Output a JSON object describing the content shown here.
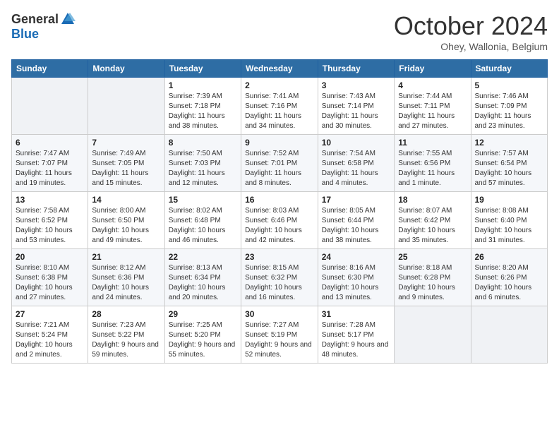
{
  "header": {
    "logo_general": "General",
    "logo_blue": "Blue",
    "month_title": "October 2024",
    "location": "Ohey, Wallonia, Belgium"
  },
  "weekdays": [
    "Sunday",
    "Monday",
    "Tuesday",
    "Wednesday",
    "Thursday",
    "Friday",
    "Saturday"
  ],
  "weeks": [
    [
      {
        "day": "",
        "sunrise": "",
        "sunset": "",
        "daylight": ""
      },
      {
        "day": "",
        "sunrise": "",
        "sunset": "",
        "daylight": ""
      },
      {
        "day": "1",
        "sunrise": "Sunrise: 7:39 AM",
        "sunset": "Sunset: 7:18 PM",
        "daylight": "Daylight: 11 hours and 38 minutes."
      },
      {
        "day": "2",
        "sunrise": "Sunrise: 7:41 AM",
        "sunset": "Sunset: 7:16 PM",
        "daylight": "Daylight: 11 hours and 34 minutes."
      },
      {
        "day": "3",
        "sunrise": "Sunrise: 7:43 AM",
        "sunset": "Sunset: 7:14 PM",
        "daylight": "Daylight: 11 hours and 30 minutes."
      },
      {
        "day": "4",
        "sunrise": "Sunrise: 7:44 AM",
        "sunset": "Sunset: 7:11 PM",
        "daylight": "Daylight: 11 hours and 27 minutes."
      },
      {
        "day": "5",
        "sunrise": "Sunrise: 7:46 AM",
        "sunset": "Sunset: 7:09 PM",
        "daylight": "Daylight: 11 hours and 23 minutes."
      }
    ],
    [
      {
        "day": "6",
        "sunrise": "Sunrise: 7:47 AM",
        "sunset": "Sunset: 7:07 PM",
        "daylight": "Daylight: 11 hours and 19 minutes."
      },
      {
        "day": "7",
        "sunrise": "Sunrise: 7:49 AM",
        "sunset": "Sunset: 7:05 PM",
        "daylight": "Daylight: 11 hours and 15 minutes."
      },
      {
        "day": "8",
        "sunrise": "Sunrise: 7:50 AM",
        "sunset": "Sunset: 7:03 PM",
        "daylight": "Daylight: 11 hours and 12 minutes."
      },
      {
        "day": "9",
        "sunrise": "Sunrise: 7:52 AM",
        "sunset": "Sunset: 7:01 PM",
        "daylight": "Daylight: 11 hours and 8 minutes."
      },
      {
        "day": "10",
        "sunrise": "Sunrise: 7:54 AM",
        "sunset": "Sunset: 6:58 PM",
        "daylight": "Daylight: 11 hours and 4 minutes."
      },
      {
        "day": "11",
        "sunrise": "Sunrise: 7:55 AM",
        "sunset": "Sunset: 6:56 PM",
        "daylight": "Daylight: 11 hours and 1 minute."
      },
      {
        "day": "12",
        "sunrise": "Sunrise: 7:57 AM",
        "sunset": "Sunset: 6:54 PM",
        "daylight": "Daylight: 10 hours and 57 minutes."
      }
    ],
    [
      {
        "day": "13",
        "sunrise": "Sunrise: 7:58 AM",
        "sunset": "Sunset: 6:52 PM",
        "daylight": "Daylight: 10 hours and 53 minutes."
      },
      {
        "day": "14",
        "sunrise": "Sunrise: 8:00 AM",
        "sunset": "Sunset: 6:50 PM",
        "daylight": "Daylight: 10 hours and 49 minutes."
      },
      {
        "day": "15",
        "sunrise": "Sunrise: 8:02 AM",
        "sunset": "Sunset: 6:48 PM",
        "daylight": "Daylight: 10 hours and 46 minutes."
      },
      {
        "day": "16",
        "sunrise": "Sunrise: 8:03 AM",
        "sunset": "Sunset: 6:46 PM",
        "daylight": "Daylight: 10 hours and 42 minutes."
      },
      {
        "day": "17",
        "sunrise": "Sunrise: 8:05 AM",
        "sunset": "Sunset: 6:44 PM",
        "daylight": "Daylight: 10 hours and 38 minutes."
      },
      {
        "day": "18",
        "sunrise": "Sunrise: 8:07 AM",
        "sunset": "Sunset: 6:42 PM",
        "daylight": "Daylight: 10 hours and 35 minutes."
      },
      {
        "day": "19",
        "sunrise": "Sunrise: 8:08 AM",
        "sunset": "Sunset: 6:40 PM",
        "daylight": "Daylight: 10 hours and 31 minutes."
      }
    ],
    [
      {
        "day": "20",
        "sunrise": "Sunrise: 8:10 AM",
        "sunset": "Sunset: 6:38 PM",
        "daylight": "Daylight: 10 hours and 27 minutes."
      },
      {
        "day": "21",
        "sunrise": "Sunrise: 8:12 AM",
        "sunset": "Sunset: 6:36 PM",
        "daylight": "Daylight: 10 hours and 24 minutes."
      },
      {
        "day": "22",
        "sunrise": "Sunrise: 8:13 AM",
        "sunset": "Sunset: 6:34 PM",
        "daylight": "Daylight: 10 hours and 20 minutes."
      },
      {
        "day": "23",
        "sunrise": "Sunrise: 8:15 AM",
        "sunset": "Sunset: 6:32 PM",
        "daylight": "Daylight: 10 hours and 16 minutes."
      },
      {
        "day": "24",
        "sunrise": "Sunrise: 8:16 AM",
        "sunset": "Sunset: 6:30 PM",
        "daylight": "Daylight: 10 hours and 13 minutes."
      },
      {
        "day": "25",
        "sunrise": "Sunrise: 8:18 AM",
        "sunset": "Sunset: 6:28 PM",
        "daylight": "Daylight: 10 hours and 9 minutes."
      },
      {
        "day": "26",
        "sunrise": "Sunrise: 8:20 AM",
        "sunset": "Sunset: 6:26 PM",
        "daylight": "Daylight: 10 hours and 6 minutes."
      }
    ],
    [
      {
        "day": "27",
        "sunrise": "Sunrise: 7:21 AM",
        "sunset": "Sunset: 5:24 PM",
        "daylight": "Daylight: 10 hours and 2 minutes."
      },
      {
        "day": "28",
        "sunrise": "Sunrise: 7:23 AM",
        "sunset": "Sunset: 5:22 PM",
        "daylight": "Daylight: 9 hours and 59 minutes."
      },
      {
        "day": "29",
        "sunrise": "Sunrise: 7:25 AM",
        "sunset": "Sunset: 5:20 PM",
        "daylight": "Daylight: 9 hours and 55 minutes."
      },
      {
        "day": "30",
        "sunrise": "Sunrise: 7:27 AM",
        "sunset": "Sunset: 5:19 PM",
        "daylight": "Daylight: 9 hours and 52 minutes."
      },
      {
        "day": "31",
        "sunrise": "Sunrise: 7:28 AM",
        "sunset": "Sunset: 5:17 PM",
        "daylight": "Daylight: 9 hours and 48 minutes."
      },
      {
        "day": "",
        "sunrise": "",
        "sunset": "",
        "daylight": ""
      },
      {
        "day": "",
        "sunrise": "",
        "sunset": "",
        "daylight": ""
      }
    ]
  ]
}
